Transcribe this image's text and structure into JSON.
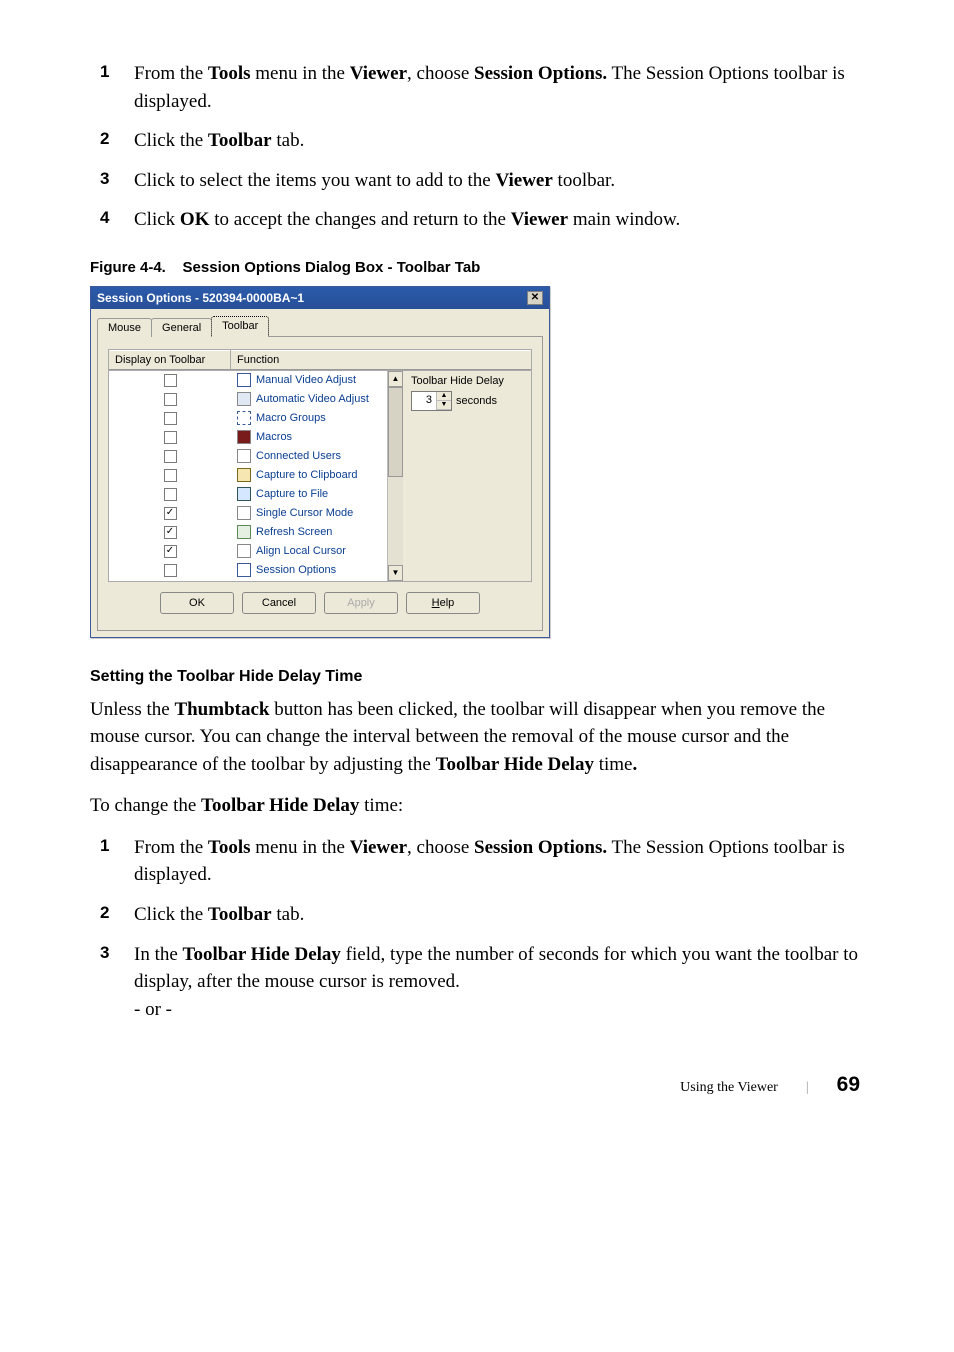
{
  "steps_top": [
    {
      "num": "1",
      "html": "From the <b>Tools</b> menu in the <b>Viewer</b>, choose <b>Session Options.</b> The Session Options toolbar is displayed."
    },
    {
      "num": "2",
      "html": "Click the <b>Toolbar</b> tab."
    },
    {
      "num": "3",
      "html": "Click to select the items you want to add to the <b>Viewer</b> toolbar."
    },
    {
      "num": "4",
      "html": "Click <b>OK</b> to accept the changes and return to the <b>Viewer</b> main window."
    }
  ],
  "figure_caption_label": "Figure 4-4.",
  "figure_caption_title": "Session Options Dialog Box - Toolbar Tab",
  "dialog": {
    "title": "Session Options - 520394-0000BA~1",
    "close_glyph": "✕",
    "tabs": {
      "mouse": "Mouse",
      "general": "General",
      "toolbar": "Toolbar"
    },
    "headers": {
      "display": "Display on Toolbar",
      "function": "Function"
    },
    "functions": [
      {
        "label": "Manual Video Adjust",
        "checked": false,
        "iconClass": "icon-manual"
      },
      {
        "label": "Automatic Video Adjust",
        "checked": false,
        "iconClass": "icon-auto"
      },
      {
        "label": "Macro Groups",
        "checked": false,
        "iconClass": "icon-macrogrp"
      },
      {
        "label": "Macros",
        "checked": false,
        "iconClass": "icon-macros"
      },
      {
        "label": "Connected Users",
        "checked": false,
        "iconClass": "icon-users"
      },
      {
        "label": "Capture to Clipboard",
        "checked": false,
        "iconClass": "icon-clip"
      },
      {
        "label": "Capture to File",
        "checked": false,
        "iconClass": "icon-file"
      },
      {
        "label": "Single Cursor Mode",
        "checked": true,
        "iconClass": "icon-single"
      },
      {
        "label": "Refresh Screen",
        "checked": true,
        "iconClass": "icon-refresh"
      },
      {
        "label": "Align Local Cursor",
        "checked": true,
        "iconClass": "icon-align"
      },
      {
        "label": "Session Options",
        "checked": false,
        "iconClass": "icon-sessopt"
      }
    ],
    "hide_delay": {
      "label": "Toolbar Hide Delay",
      "value": "3",
      "unit": "seconds"
    },
    "buttons": {
      "ok": "OK",
      "cancel": "Cancel",
      "apply": "Apply",
      "help": "Help",
      "help_acc": "H"
    },
    "scroll": {
      "up": "▲",
      "down": "▼"
    },
    "spin": {
      "up": "▲",
      "down": "▼"
    }
  },
  "section_heading": "Setting the Toolbar Hide Delay Time",
  "para1_html": "Unless the <b>Thumbtack</b> button has been clicked, the toolbar will disappear when you remove the mouse cursor. You can change the interval between the removal of the mouse cursor and the disappearance of the toolbar by adjusting the <b>Toolbar Hide Delay</b> time<b>.</b>",
  "para2_html": "To change the <b>Toolbar Hide Delay</b> time:",
  "steps_bottom": [
    {
      "num": "1",
      "html": "From the <b>Tools</b> menu in the <b>Viewer</b>, choose <b>Session Options.</b> The Session Options toolbar is displayed."
    },
    {
      "num": "2",
      "html": "Click the <b>Toolbar</b> tab."
    },
    {
      "num": "3",
      "html": "In the <b>Toolbar Hide Delay</b> field, type the number of seconds for which you want the toolbar to display, after the mouse cursor is removed.<br>- or -"
    }
  ],
  "footer": {
    "section": "Using the Viewer",
    "page": "69"
  }
}
